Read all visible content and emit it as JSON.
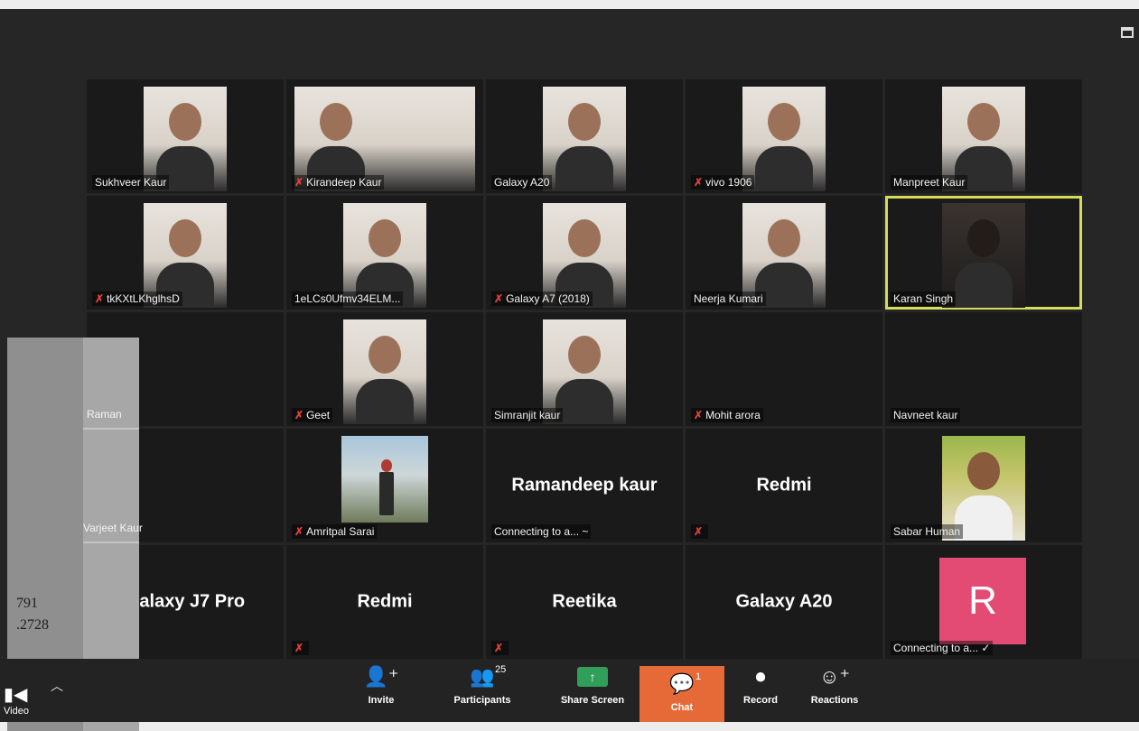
{
  "grid": {
    "tiles": [
      {
        "name": "Sukhveer Kaur",
        "muted": false,
        "video": true
      },
      {
        "name": "Kirandeep Kaur",
        "muted": true,
        "video": true
      },
      {
        "name": "Galaxy A20",
        "muted": false,
        "video": true
      },
      {
        "name": "vivo 1906",
        "muted": true,
        "video": true
      },
      {
        "name": "Manpreet Kaur",
        "muted": false,
        "video": true
      },
      {
        "name": "tkKXtLKhglhsD",
        "muted": true,
        "video": true
      },
      {
        "name": "1eLCs0Ufmv34ELM...",
        "muted": false,
        "video": true
      },
      {
        "name": "Galaxy A7 (2018)",
        "muted": true,
        "video": true
      },
      {
        "name": "Neerja Kumari",
        "muted": false,
        "video": true
      },
      {
        "name": "Karan Singh",
        "muted": false,
        "video": true,
        "active": true
      },
      {
        "name": "",
        "muted": false,
        "video": false
      },
      {
        "name": "Geet",
        "muted": true,
        "video": true
      },
      {
        "name": "Simranjit kaur",
        "muted": false,
        "video": true
      },
      {
        "name": "Mohit arora",
        "muted": true,
        "video": false
      },
      {
        "name": "Navneet kaur",
        "muted": false,
        "video": false
      },
      {
        "name": "",
        "muted": false,
        "video": false
      },
      {
        "name": "Amritpal Sarai",
        "muted": true,
        "video": true
      },
      {
        "name": "Connecting to a... ~",
        "center": "Ramandeep kaur",
        "muted": false,
        "video": false
      },
      {
        "name": "",
        "center": "Redmi",
        "muted": true,
        "video": false
      },
      {
        "name": "Sabar Human",
        "muted": false,
        "video": true
      },
      {
        "name": "",
        "center": "Galaxy J7 Pro",
        "muted": false,
        "video": false
      },
      {
        "name": "",
        "center": "Redmi",
        "muted": true,
        "video": false
      },
      {
        "name": "",
        "center": "Reetika",
        "muted": true,
        "video": false
      },
      {
        "name": "",
        "center": "Galaxy A20",
        "muted": false,
        "video": false
      },
      {
        "name": "Connecting to a... ✓",
        "avatar": "R",
        "muted": false,
        "video": false
      }
    ]
  },
  "side": {
    "raman": "Raman",
    "varjeet": "Varjeet Kaur",
    "number1": "791",
    "number2": ".2728"
  },
  "toolbar": {
    "video_label": "Video",
    "invite_label": "Invite",
    "participants_label": "Participants",
    "participants_count": "25",
    "share_label": "Share Screen",
    "chat_label": "Chat",
    "chat_count": "1",
    "record_label": "Record",
    "reactions_label": "Reactions"
  },
  "colors": {
    "chat_accent": "#e56a38",
    "share_green": "#2f9f5a",
    "active_speaker": "#d6dc5a",
    "avatar_pink": "#e34b75",
    "mute_red": "#e0413a"
  }
}
